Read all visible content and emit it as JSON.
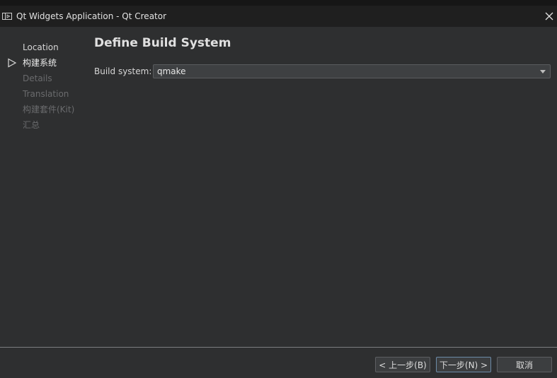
{
  "window": {
    "title": "Qt Widgets Application - Qt Creator",
    "app_icon": "qt-creator-icon",
    "close_icon": "close-icon"
  },
  "sidebar": {
    "items": [
      {
        "label": "Location",
        "state": "done"
      },
      {
        "label": "构建系统",
        "state": "current"
      },
      {
        "label": "Details",
        "state": "future"
      },
      {
        "label": "Translation",
        "state": "future"
      },
      {
        "label": "构建套件(Kit)",
        "state": "future"
      },
      {
        "label": "汇总",
        "state": "future"
      }
    ],
    "current_marker_icon": "triangle-right-outline-icon"
  },
  "page": {
    "title": "Define Build System",
    "build_system_label": "Build system:",
    "build_system_value": "qmake"
  },
  "buttons": {
    "back_label": "< 上一步(B)",
    "next_label": "下一步(N) >",
    "cancel_label": "取消"
  },
  "colors": {
    "background": "#2e2f30",
    "titlebar": "#1f1f1f",
    "disabled_text": "#6a6b6d",
    "separator": "#7c7e80"
  }
}
